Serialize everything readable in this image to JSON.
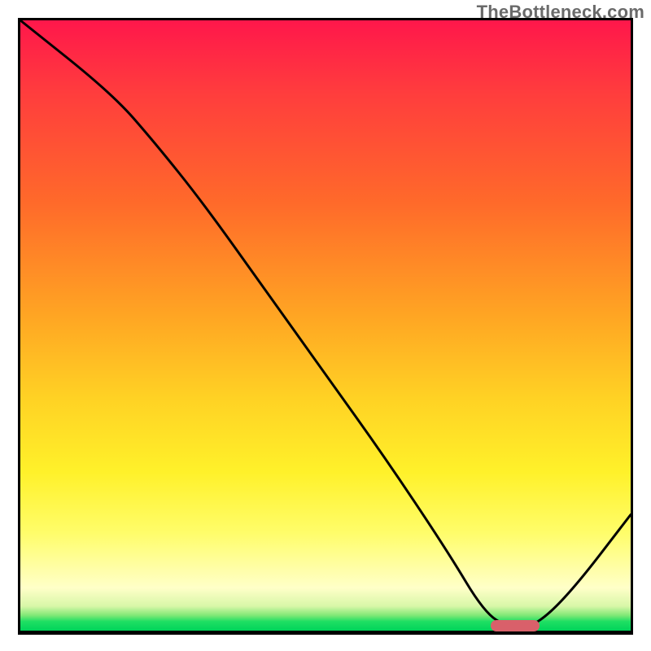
{
  "watermark": "TheBottleneck.com",
  "chart_data": {
    "type": "line",
    "title": "",
    "xlabel": "",
    "ylabel": "",
    "xlim": [
      0,
      100
    ],
    "ylim": [
      0,
      100
    ],
    "grid": false,
    "series": [
      {
        "name": "bottleneck-curve",
        "x": [
          0,
          15,
          22,
          30,
          40,
          50,
          60,
          70,
          76,
          80,
          84,
          90,
          100
        ],
        "values": [
          100,
          88,
          80,
          70,
          56,
          42,
          28,
          13,
          3,
          0.5,
          0.5,
          6,
          19
        ]
      }
    ],
    "optimal_marker": {
      "x_start": 77,
      "x_end": 85,
      "y": 0.8
    },
    "gradient_stops": [
      {
        "pct": 0,
        "color": "#ff174b"
      },
      {
        "pct": 30,
        "color": "#ff6a2a"
      },
      {
        "pct": 62,
        "color": "#ffd224"
      },
      {
        "pct": 93,
        "color": "#ffffc8"
      },
      {
        "pct": 100,
        "color": "#00d45a"
      }
    ]
  }
}
